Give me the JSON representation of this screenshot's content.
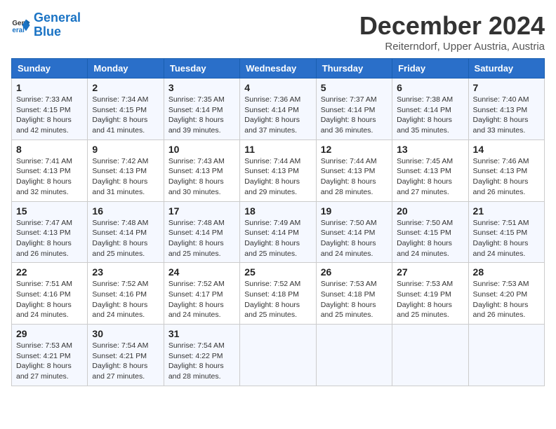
{
  "header": {
    "logo_line1": "General",
    "logo_line2": "Blue",
    "month": "December 2024",
    "location": "Reiterndorf, Upper Austria, Austria"
  },
  "weekdays": [
    "Sunday",
    "Monday",
    "Tuesday",
    "Wednesday",
    "Thursday",
    "Friday",
    "Saturday"
  ],
  "weeks": [
    [
      {
        "day": "1",
        "sunrise": "7:33 AM",
        "sunset": "4:15 PM",
        "daylight": "8 hours and 42 minutes."
      },
      {
        "day": "2",
        "sunrise": "7:34 AM",
        "sunset": "4:15 PM",
        "daylight": "8 hours and 41 minutes."
      },
      {
        "day": "3",
        "sunrise": "7:35 AM",
        "sunset": "4:14 PM",
        "daylight": "8 hours and 39 minutes."
      },
      {
        "day": "4",
        "sunrise": "7:36 AM",
        "sunset": "4:14 PM",
        "daylight": "8 hours and 37 minutes."
      },
      {
        "day": "5",
        "sunrise": "7:37 AM",
        "sunset": "4:14 PM",
        "daylight": "8 hours and 36 minutes."
      },
      {
        "day": "6",
        "sunrise": "7:38 AM",
        "sunset": "4:14 PM",
        "daylight": "8 hours and 35 minutes."
      },
      {
        "day": "7",
        "sunrise": "7:40 AM",
        "sunset": "4:13 PM",
        "daylight": "8 hours and 33 minutes."
      }
    ],
    [
      {
        "day": "8",
        "sunrise": "7:41 AM",
        "sunset": "4:13 PM",
        "daylight": "8 hours and 32 minutes."
      },
      {
        "day": "9",
        "sunrise": "7:42 AM",
        "sunset": "4:13 PM",
        "daylight": "8 hours and 31 minutes."
      },
      {
        "day": "10",
        "sunrise": "7:43 AM",
        "sunset": "4:13 PM",
        "daylight": "8 hours and 30 minutes."
      },
      {
        "day": "11",
        "sunrise": "7:44 AM",
        "sunset": "4:13 PM",
        "daylight": "8 hours and 29 minutes."
      },
      {
        "day": "12",
        "sunrise": "7:44 AM",
        "sunset": "4:13 PM",
        "daylight": "8 hours and 28 minutes."
      },
      {
        "day": "13",
        "sunrise": "7:45 AM",
        "sunset": "4:13 PM",
        "daylight": "8 hours and 27 minutes."
      },
      {
        "day": "14",
        "sunrise": "7:46 AM",
        "sunset": "4:13 PM",
        "daylight": "8 hours and 26 minutes."
      }
    ],
    [
      {
        "day": "15",
        "sunrise": "7:47 AM",
        "sunset": "4:13 PM",
        "daylight": "8 hours and 26 minutes."
      },
      {
        "day": "16",
        "sunrise": "7:48 AM",
        "sunset": "4:14 PM",
        "daylight": "8 hours and 25 minutes."
      },
      {
        "day": "17",
        "sunrise": "7:48 AM",
        "sunset": "4:14 PM",
        "daylight": "8 hours and 25 minutes."
      },
      {
        "day": "18",
        "sunrise": "7:49 AM",
        "sunset": "4:14 PM",
        "daylight": "8 hours and 25 minutes."
      },
      {
        "day": "19",
        "sunrise": "7:50 AM",
        "sunset": "4:14 PM",
        "daylight": "8 hours and 24 minutes."
      },
      {
        "day": "20",
        "sunrise": "7:50 AM",
        "sunset": "4:15 PM",
        "daylight": "8 hours and 24 minutes."
      },
      {
        "day": "21",
        "sunrise": "7:51 AM",
        "sunset": "4:15 PM",
        "daylight": "8 hours and 24 minutes."
      }
    ],
    [
      {
        "day": "22",
        "sunrise": "7:51 AM",
        "sunset": "4:16 PM",
        "daylight": "8 hours and 24 minutes."
      },
      {
        "day": "23",
        "sunrise": "7:52 AM",
        "sunset": "4:16 PM",
        "daylight": "8 hours and 24 minutes."
      },
      {
        "day": "24",
        "sunrise": "7:52 AM",
        "sunset": "4:17 PM",
        "daylight": "8 hours and 24 minutes."
      },
      {
        "day": "25",
        "sunrise": "7:52 AM",
        "sunset": "4:18 PM",
        "daylight": "8 hours and 25 minutes."
      },
      {
        "day": "26",
        "sunrise": "7:53 AM",
        "sunset": "4:18 PM",
        "daylight": "8 hours and 25 minutes."
      },
      {
        "day": "27",
        "sunrise": "7:53 AM",
        "sunset": "4:19 PM",
        "daylight": "8 hours and 25 minutes."
      },
      {
        "day": "28",
        "sunrise": "7:53 AM",
        "sunset": "4:20 PM",
        "daylight": "8 hours and 26 minutes."
      }
    ],
    [
      {
        "day": "29",
        "sunrise": "7:53 AM",
        "sunset": "4:21 PM",
        "daylight": "8 hours and 27 minutes."
      },
      {
        "day": "30",
        "sunrise": "7:54 AM",
        "sunset": "4:21 PM",
        "daylight": "8 hours and 27 minutes."
      },
      {
        "day": "31",
        "sunrise": "7:54 AM",
        "sunset": "4:22 PM",
        "daylight": "8 hours and 28 minutes."
      },
      null,
      null,
      null,
      null
    ]
  ]
}
